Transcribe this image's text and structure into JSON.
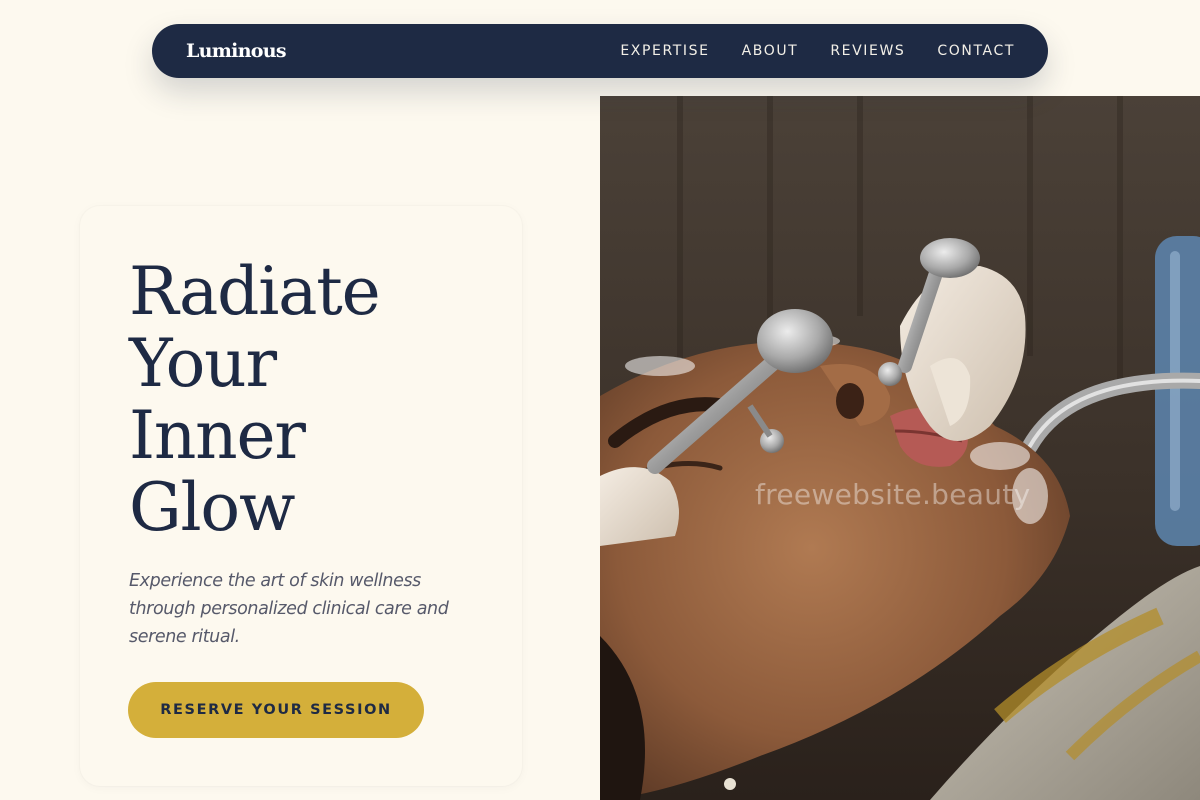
{
  "brand": {
    "name": "Luminous"
  },
  "nav": {
    "links": [
      {
        "label": "EXPERTISE"
      },
      {
        "label": "ABOUT"
      },
      {
        "label": "REVIEWS"
      },
      {
        "label": "CONTACT"
      }
    ]
  },
  "hero": {
    "title_lines": [
      "Radiate",
      "Your",
      "Inner",
      "Glow"
    ],
    "subtitle": "Experience the art of skin wellness through personalized clinical care and serene ritual.",
    "cta_label": "RESERVE YOUR SESSION",
    "image": {
      "subject": "facial-treatment-photo",
      "watermark": "freewebsite.beauty"
    }
  },
  "colors": {
    "background": "#fdf9ef",
    "navy": "#1e2a44",
    "gold": "#d4af3a",
    "muted_text": "#56596a"
  }
}
